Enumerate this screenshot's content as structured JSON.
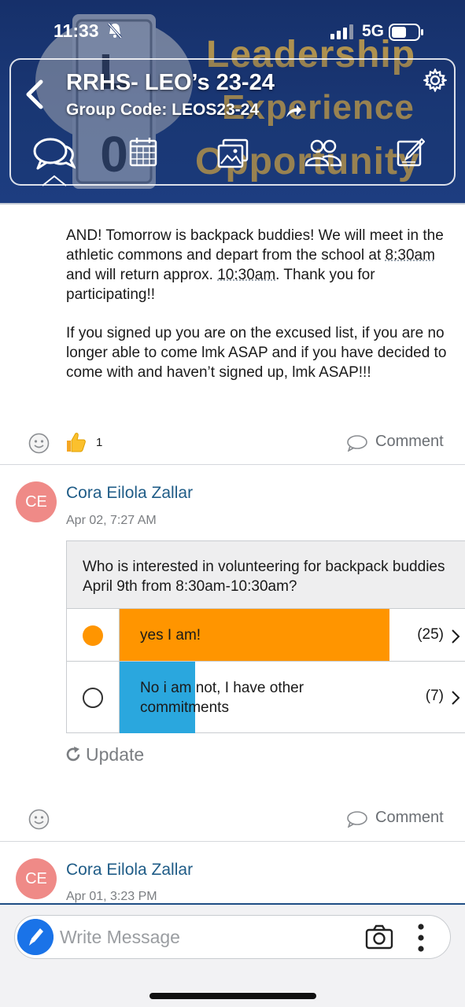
{
  "status_bar": {
    "time": "11:33",
    "network": "5G"
  },
  "header": {
    "group_title": "RRHS- LEO’s 23-24",
    "group_code": "Group Code: LEOS23-24",
    "brand_lines": [
      "Leadership",
      "Experience",
      "Opportunity"
    ],
    "emblem_letters": [
      "L",
      "0"
    ],
    "nav_tabs": [
      "chat-icon",
      "calendar-icon",
      "photos-icon",
      "members-icon",
      "notes-icon"
    ],
    "active_tab": "chat-icon",
    "colors": {
      "background": "#1b3a7a",
      "brand_gold": "#c9a24a"
    }
  },
  "feed": {
    "post1": {
      "paragraph1": {
        "before_time1": "AND! Tomorrow is backpack buddies! We will meet in the athletic commons and depart from the school at ",
        "time1": "8:30am",
        "between": " and will return approx. ",
        "time2": "10:30am",
        "after": ". Thank you for participating!!"
      },
      "paragraph2": "If you signed up you are on the excused list, if you are no longer able to come lmk ASAP and if you have decided to come with and haven’t signed up, lmk ASAP!!!",
      "like_count": "1",
      "comment_label": "Comment"
    },
    "post2": {
      "avatar_initials": "CE",
      "author": "Cora Eilola Zallar",
      "timestamp": "Apr 02, 7:27 AM",
      "poll": {
        "question": "Who is interested in volunteering for backpack buddies April 9th from 8:30am-10:30am?",
        "options": [
          {
            "label": "yes I am!",
            "count": "(25)",
            "votes": 25,
            "selected": true,
            "color": "#ff9500"
          },
          {
            "label": "No i am not, I have other commitments",
            "count": "(7)",
            "votes": 7,
            "selected": false,
            "color": "#2aa7de"
          }
        ]
      },
      "update_label": "Update",
      "comment_label": "Comment"
    },
    "post3": {
      "avatar_initials": "CE",
      "author": "Cora Eilola Zallar",
      "timestamp": "Apr 01, 3:23 PM"
    }
  },
  "composer": {
    "placeholder": "Write Message"
  }
}
